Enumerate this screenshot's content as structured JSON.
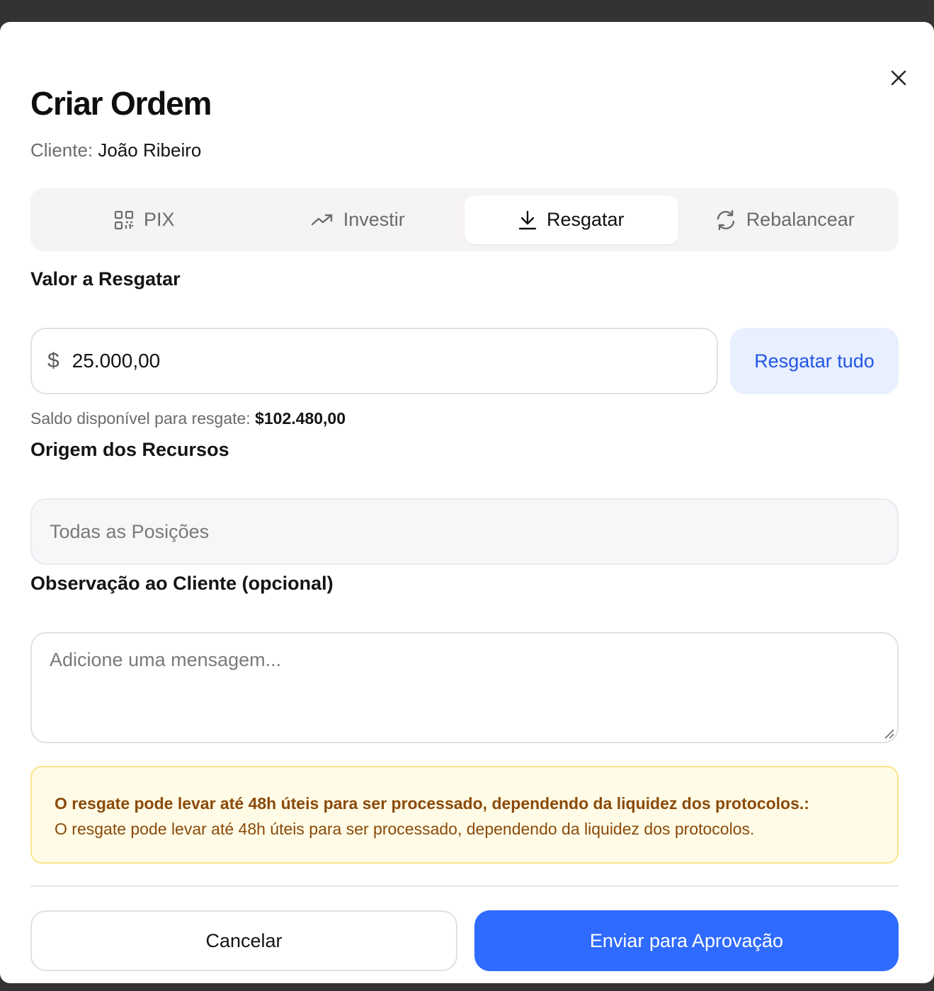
{
  "modal": {
    "title": "Criar Ordem",
    "client_label": "Cliente:",
    "client_name": "João Ribeiro"
  },
  "tabs": [
    {
      "label": "PIX",
      "icon": "qr-code-icon",
      "active": false
    },
    {
      "label": "Investir",
      "icon": "trending-up-icon",
      "active": false
    },
    {
      "label": "Resgatar",
      "icon": "download-icon",
      "active": true
    },
    {
      "label": "Rebalancear",
      "icon": "refresh-icon",
      "active": false
    }
  ],
  "amount": {
    "label": "Valor a Resgatar",
    "currency": "$",
    "value": "25.000,00",
    "redeem_all_label": "Resgatar tudo",
    "balance_label": "Saldo disponível para resgate:",
    "balance_value": "$102.480,00"
  },
  "source": {
    "label": "Origem dos Recursos",
    "selected": "Todas as Posições"
  },
  "note": {
    "label": "Observação ao Cliente (opcional)",
    "placeholder": "Adicione uma mensagem..."
  },
  "alert": {
    "title": "O resgate pode levar até 48h úteis para ser processado, dependendo da liquidez dos protocolos.:",
    "body": "O resgate pode levar até 48h úteis para ser processado, dependendo da liquidez dos protocolos."
  },
  "footer": {
    "cancel_label": "Cancelar",
    "submit_label": "Enviar para Aprovação"
  },
  "colors": {
    "primary": "#2f6bff",
    "link": "#2156e6",
    "warning_text": "#8a4a0a",
    "warning_bg": "#fffbe6"
  }
}
